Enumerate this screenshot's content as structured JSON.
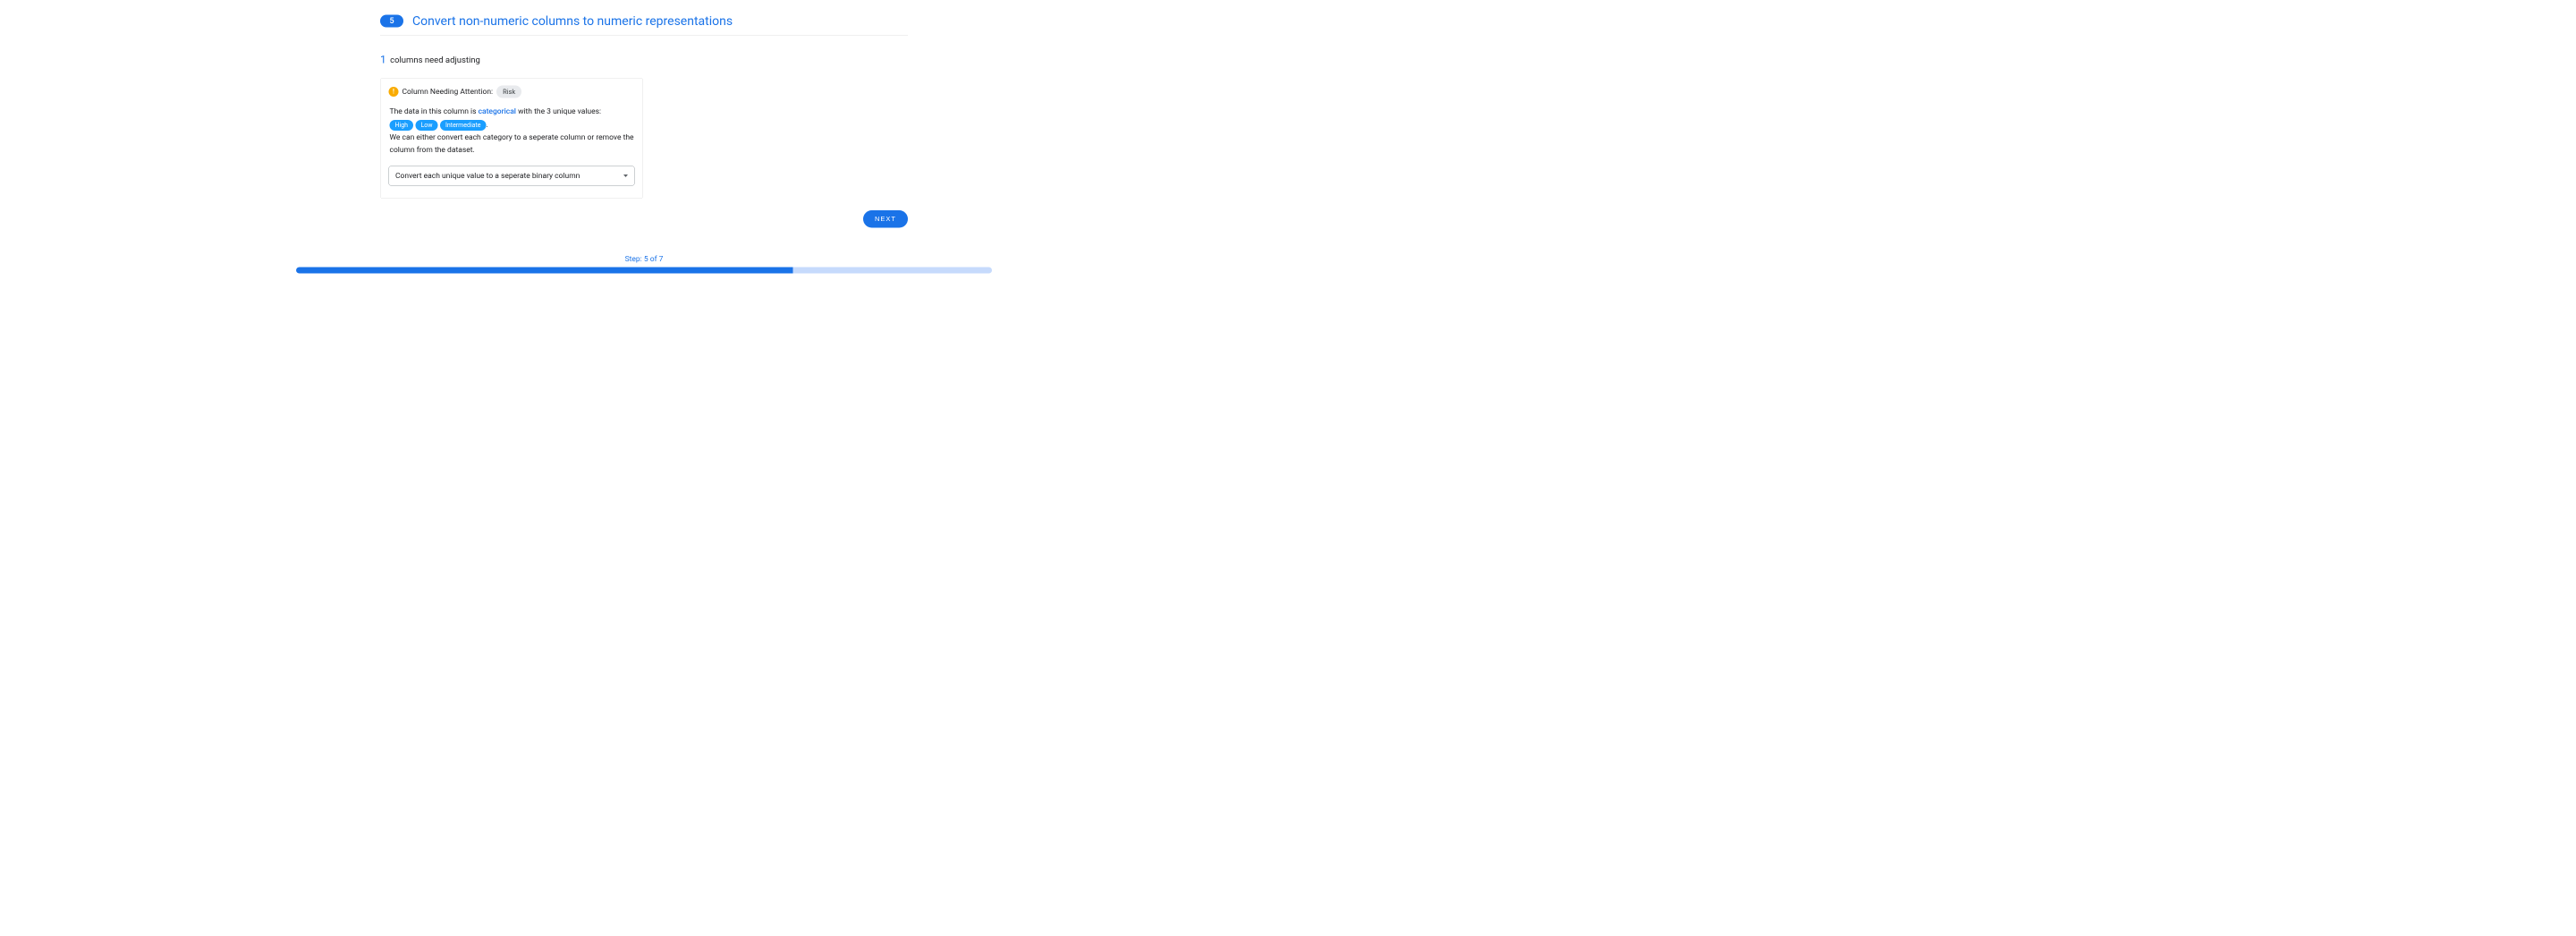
{
  "step": {
    "number": "5",
    "title": "Convert non-numeric columns to numeric representations"
  },
  "summary": {
    "count": "1",
    "text": "columns need adjusting"
  },
  "card": {
    "alert_glyph": "!",
    "head_label": "Column Needing Attention:",
    "column_name": "Risk",
    "desc_prefix": "The data in this column is ",
    "desc_keyword": "categorical",
    "desc_mid": " with the 3 unique values:",
    "values": [
      "High",
      "Low",
      "Intermediate"
    ],
    "desc_period": ".",
    "desc_line2": "We can either convert each category to a seperate column or remove the column from the dataset.",
    "select_value": "Convert each unique value to a seperate binary column"
  },
  "actions": {
    "next_label": "NEXT"
  },
  "progress": {
    "label": "Step: 5 of 7",
    "percent": 71.4
  }
}
